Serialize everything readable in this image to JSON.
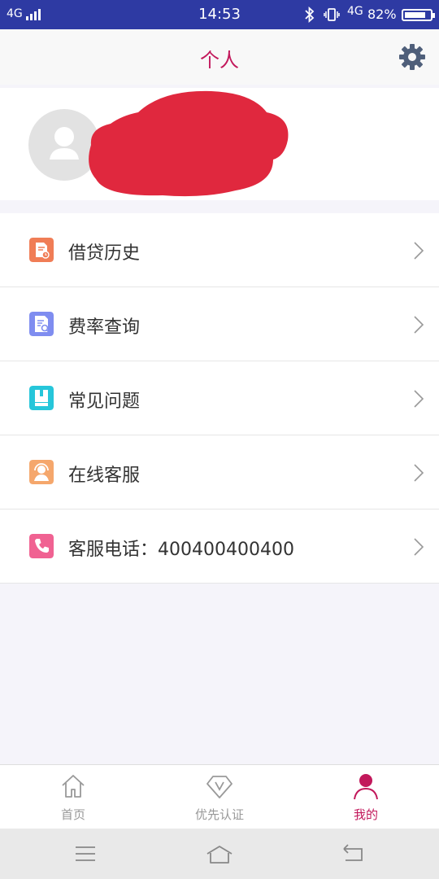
{
  "status_bar": {
    "network_left": "4G",
    "time": "14:53",
    "network_right": "4G",
    "battery_percent": "82%",
    "battery_level": 0.82
  },
  "header": {
    "title": "个人"
  },
  "profile": {
    "avatar_icon": "person-avatar-icon",
    "name_redacted": true
  },
  "menu": {
    "items": [
      {
        "label": "借贷历史",
        "icon": "loan-history-icon",
        "color": "#f07d56"
      },
      {
        "label": "费率查询",
        "icon": "rate-search-icon",
        "color": "#7f8df0"
      },
      {
        "label": "常见问题",
        "icon": "faq-book-icon",
        "color": "#26c6da"
      },
      {
        "label": "在线客服",
        "icon": "customer-service-icon",
        "color": "#f5a76c"
      },
      {
        "label": "客服电话：400400400400",
        "icon": "phone-icon",
        "color": "#f06292"
      }
    ]
  },
  "tabs": [
    {
      "label": "首页",
      "icon": "home-icon",
      "active": false
    },
    {
      "label": "优先认证",
      "icon": "diamond-v-icon",
      "active": false
    },
    {
      "label": "我的",
      "icon": "person-icon",
      "active": true
    }
  ],
  "colors": {
    "accent": "#c2185b",
    "status_bar": "#2e3aa3",
    "redaction": "#e0283e"
  }
}
